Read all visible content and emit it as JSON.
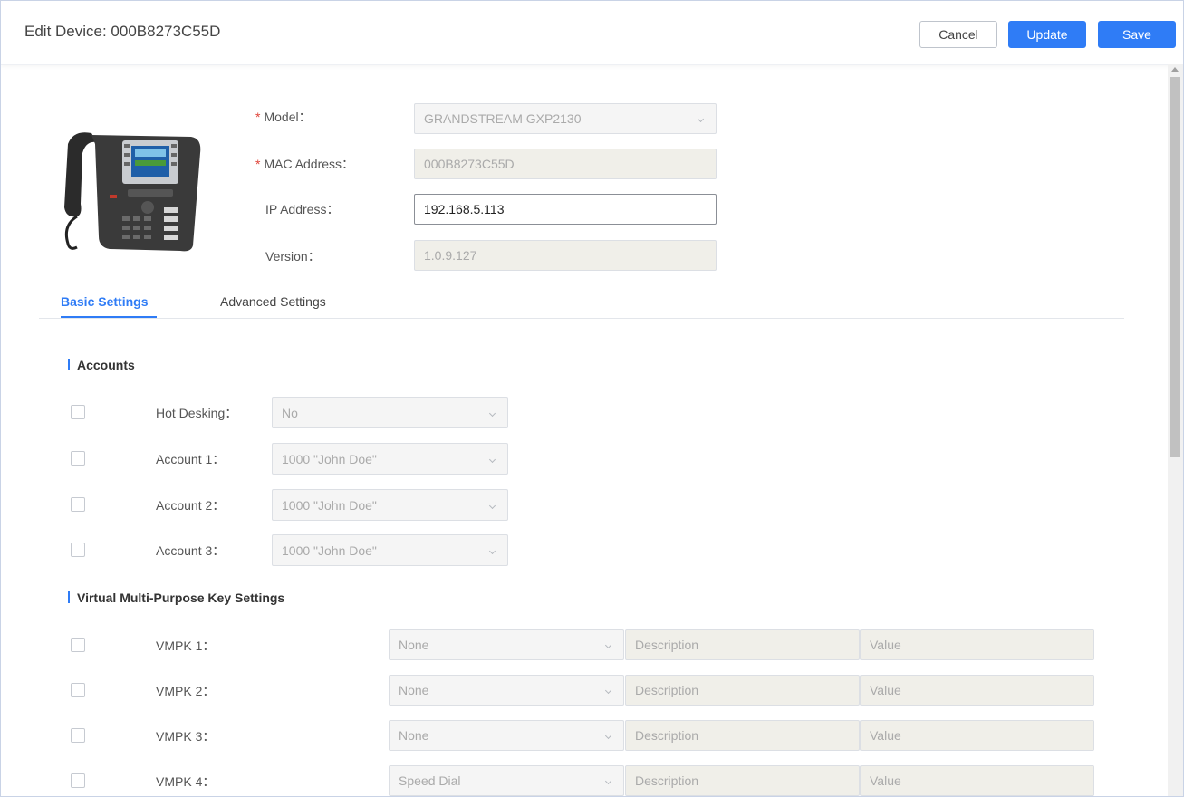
{
  "header": {
    "title": "Edit Device: 000B8273C55D",
    "cancel_label": "Cancel",
    "update_label": "Update",
    "save_label": "Save"
  },
  "device": {
    "model_label": "Model：",
    "model_value": "GRANDSTREAM GXP2130",
    "mac_label": "MAC Address：",
    "mac_value": "000B8273C55D",
    "ip_label": "IP Address：",
    "ip_value": "192.168.5.113",
    "version_label": "Version：",
    "version_value": "1.0.9.127",
    "required_mark": "*"
  },
  "tabs": [
    {
      "label": "Basic Settings",
      "active": true
    },
    {
      "label": "Advanced Settings",
      "active": false
    }
  ],
  "accounts": {
    "section_title": "Accounts",
    "rows": [
      {
        "label": "Hot Desking：",
        "value": "No",
        "checked": false
      },
      {
        "label": "Account 1：",
        "value": "1000 \"John Doe\"",
        "checked": false
      },
      {
        "label": "Account 2：",
        "value": "1000 \"John Doe\"",
        "checked": false
      },
      {
        "label": "Account 3：",
        "value": "1000 \"John Doe\"",
        "checked": false
      }
    ]
  },
  "vmpk": {
    "section_title": "Virtual Multi-Purpose Key Settings",
    "rows": [
      {
        "label": "VMPK 1：",
        "type": "None",
        "description_placeholder": "Description",
        "value_placeholder": "Value",
        "checked": false
      },
      {
        "label": "VMPK 2：",
        "type": "None",
        "description_placeholder": "Description",
        "value_placeholder": "Value",
        "checked": false
      },
      {
        "label": "VMPK 3：",
        "type": "None",
        "description_placeholder": "Description",
        "value_placeholder": "Value",
        "checked": false
      },
      {
        "label": "VMPK 4：",
        "type": "Speed Dial",
        "description_placeholder": "Description",
        "value_placeholder": "Value",
        "checked": false
      }
    ]
  },
  "colors": {
    "accent": "#2f7cf6",
    "required": "#e0453a",
    "disabled_field": "#f0efe9"
  },
  "icons": [
    "phone-image",
    "chevron-down-icon",
    "scroll-up-arrow-icon"
  ]
}
